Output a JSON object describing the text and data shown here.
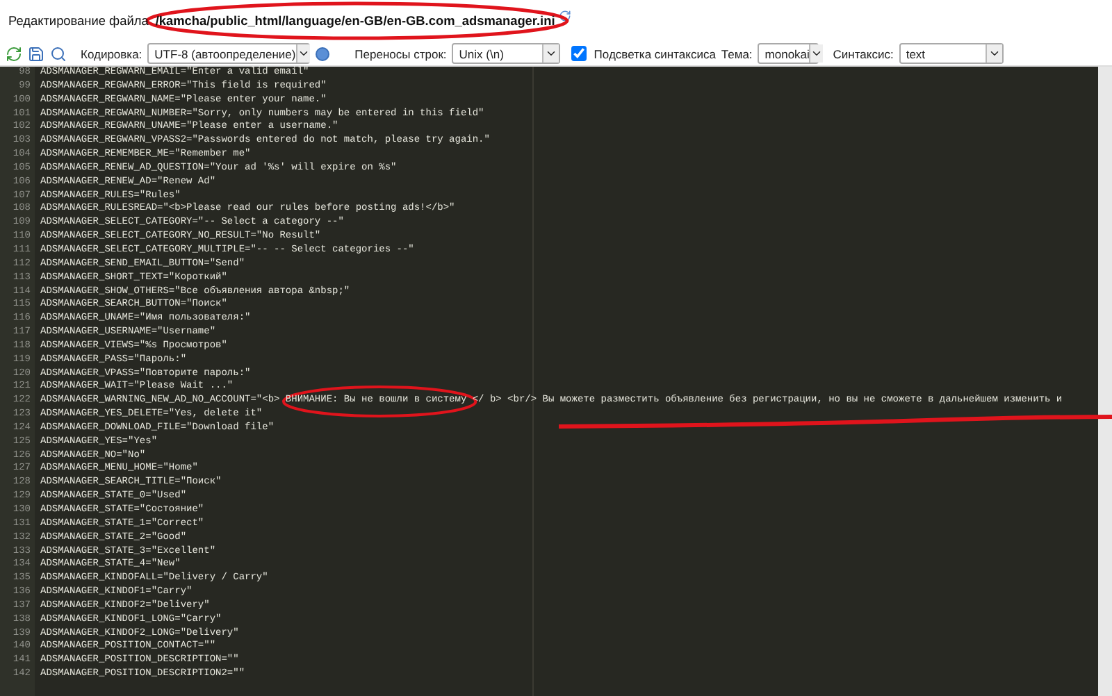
{
  "title": {
    "label": "Редактирование файла",
    "path": "/kamcha/public_html/language/en-GB/en-GB.com_adsmanager.ini"
  },
  "toolbar": {
    "encoding": {
      "label": "Кодировка:",
      "value": "UTF-8 (автоопределение)"
    },
    "line_endings": {
      "label": "Переносы строк:",
      "value": "Unix (\\n)"
    },
    "syntax_highlight": {
      "label": "Подсветка синтаксиса",
      "checked": true
    },
    "theme": {
      "label": "Тема:",
      "value": "monokai"
    },
    "syntax": {
      "label": "Синтаксис:",
      "value": "text"
    }
  },
  "editor": {
    "lines": [
      {
        "number": "98",
        "text": "ADSMANAGER_REGWARN_EMAIL=\"Enter a valid email\""
      },
      {
        "number": "99",
        "text": "ADSMANAGER_REGWARN_ERROR=\"This field is required\""
      },
      {
        "number": "100",
        "text": "ADSMANAGER_REGWARN_NAME=\"Please enter your name.\""
      },
      {
        "number": "101",
        "text": "ADSMANAGER_REGWARN_NUMBER=\"Sorry, only numbers may be entered in this field\""
      },
      {
        "number": "102",
        "text": "ADSMANAGER_REGWARN_UNAME=\"Please enter a username.\""
      },
      {
        "number": "103",
        "text": "ADSMANAGER_REGWARN_VPASS2=\"Passwords entered do not match, please try again.\""
      },
      {
        "number": "104",
        "text": "ADSMANAGER_REMEMBER_ME=\"Remember me\""
      },
      {
        "number": "105",
        "text": "ADSMANAGER_RENEW_AD_QUESTION=\"Your ad '%s' will expire on %s\""
      },
      {
        "number": "106",
        "text": "ADSMANAGER_RENEW_AD=\"Renew Ad\""
      },
      {
        "number": "107",
        "text": "ADSMANAGER_RULES=\"Rules\""
      },
      {
        "number": "108",
        "text": "ADSMANAGER_RULESREAD=\"<b>Please read our rules before posting ads!</b>\""
      },
      {
        "number": "109",
        "text": "ADSMANAGER_SELECT_CATEGORY=\"-- Select a category --\""
      },
      {
        "number": "110",
        "text": "ADSMANAGER_SELECT_CATEGORY_NO_RESULT=\"No Result\""
      },
      {
        "number": "111",
        "text": "ADSMANAGER_SELECT_CATEGORY_MULTIPLE=\"-- -- Select categories --\""
      },
      {
        "number": "112",
        "text": "ADSMANAGER_SEND_EMAIL_BUTTON=\"Send\""
      },
      {
        "number": "113",
        "text": "ADSMANAGER_SHORT_TEXT=\"Короткий\""
      },
      {
        "number": "114",
        "text": "ADSMANAGER_SHOW_OTHERS=\"Все объявления автора &nbsp;\""
      },
      {
        "number": "115",
        "text": "ADSMANAGER_SEARCH_BUTTON=\"Поиск\""
      },
      {
        "number": "116",
        "text": "ADSMANAGER_UNAME=\"Имя пользователя:\""
      },
      {
        "number": "117",
        "text": "ADSMANAGER_USERNAME=\"Username\""
      },
      {
        "number": "118",
        "text": "ADSMANAGER_VIEWS=\"%s Просмотров\""
      },
      {
        "number": "119",
        "text": "ADSMANAGER_PASS=\"Пароль:\""
      },
      {
        "number": "120",
        "text": "ADSMANAGER_VPASS=\"Повторите пароль:\""
      },
      {
        "number": "121",
        "text": "ADSMANAGER_WAIT=\"Please Wait ...\""
      },
      {
        "number": "122",
        "text": "ADSMANAGER_WARNING_NEW_AD_NO_ACCOUNT=\"<b> ВНИМАНИЕ: Вы не вошли в систему </ b> <br/> Вы можете разместить объявление без регистрации, но вы не сможете в дальнейшем изменить и"
      },
      {
        "number": "123",
        "text": "ADSMANAGER_YES_DELETE=\"Yes, delete it\""
      },
      {
        "number": "124",
        "text": "ADSMANAGER_DOWNLOAD_FILE=\"Download file\""
      },
      {
        "number": "125",
        "text": "ADSMANAGER_YES=\"Yes\""
      },
      {
        "number": "126",
        "text": "ADSMANAGER_NO=\"No\""
      },
      {
        "number": "127",
        "text": "ADSMANAGER_MENU_HOME=\"Home\""
      },
      {
        "number": "128",
        "text": "ADSMANAGER_SEARCH_TITLE=\"Поиск\""
      },
      {
        "number": "129",
        "text": "ADSMANAGER_STATE_0=\"Used\""
      },
      {
        "number": "130",
        "text": "ADSMANAGER_STATE=\"Состояние\""
      },
      {
        "number": "131",
        "text": "ADSMANAGER_STATE_1=\"Correct\""
      },
      {
        "number": "132",
        "text": "ADSMANAGER_STATE_2=\"Good\""
      },
      {
        "number": "133",
        "text": "ADSMANAGER_STATE_3=\"Excellent\""
      },
      {
        "number": "134",
        "text": "ADSMANAGER_STATE_4=\"New\""
      },
      {
        "number": "135",
        "text": "ADSMANAGER_KINDOFALL=\"Delivery / Carry\""
      },
      {
        "number": "136",
        "text": "ADSMANAGER_KINDOF1=\"Carry\""
      },
      {
        "number": "137",
        "text": "ADSMANAGER_KINDOF2=\"Delivery\""
      },
      {
        "number": "138",
        "text": "ADSMANAGER_KINDOF1_LONG=\"Carry\""
      },
      {
        "number": "139",
        "text": "ADSMANAGER_KINDOF2_LONG=\"Delivery\""
      },
      {
        "number": "140",
        "text": "ADSMANAGER_POSITION_CONTACT=\"\""
      },
      {
        "number": "141",
        "text": "ADSMANAGER_POSITION_DESCRIPTION=\"\""
      },
      {
        "number": "142",
        "text": "ADSMANAGER_POSITION_DESCRIPTION2=\"\""
      }
    ]
  }
}
